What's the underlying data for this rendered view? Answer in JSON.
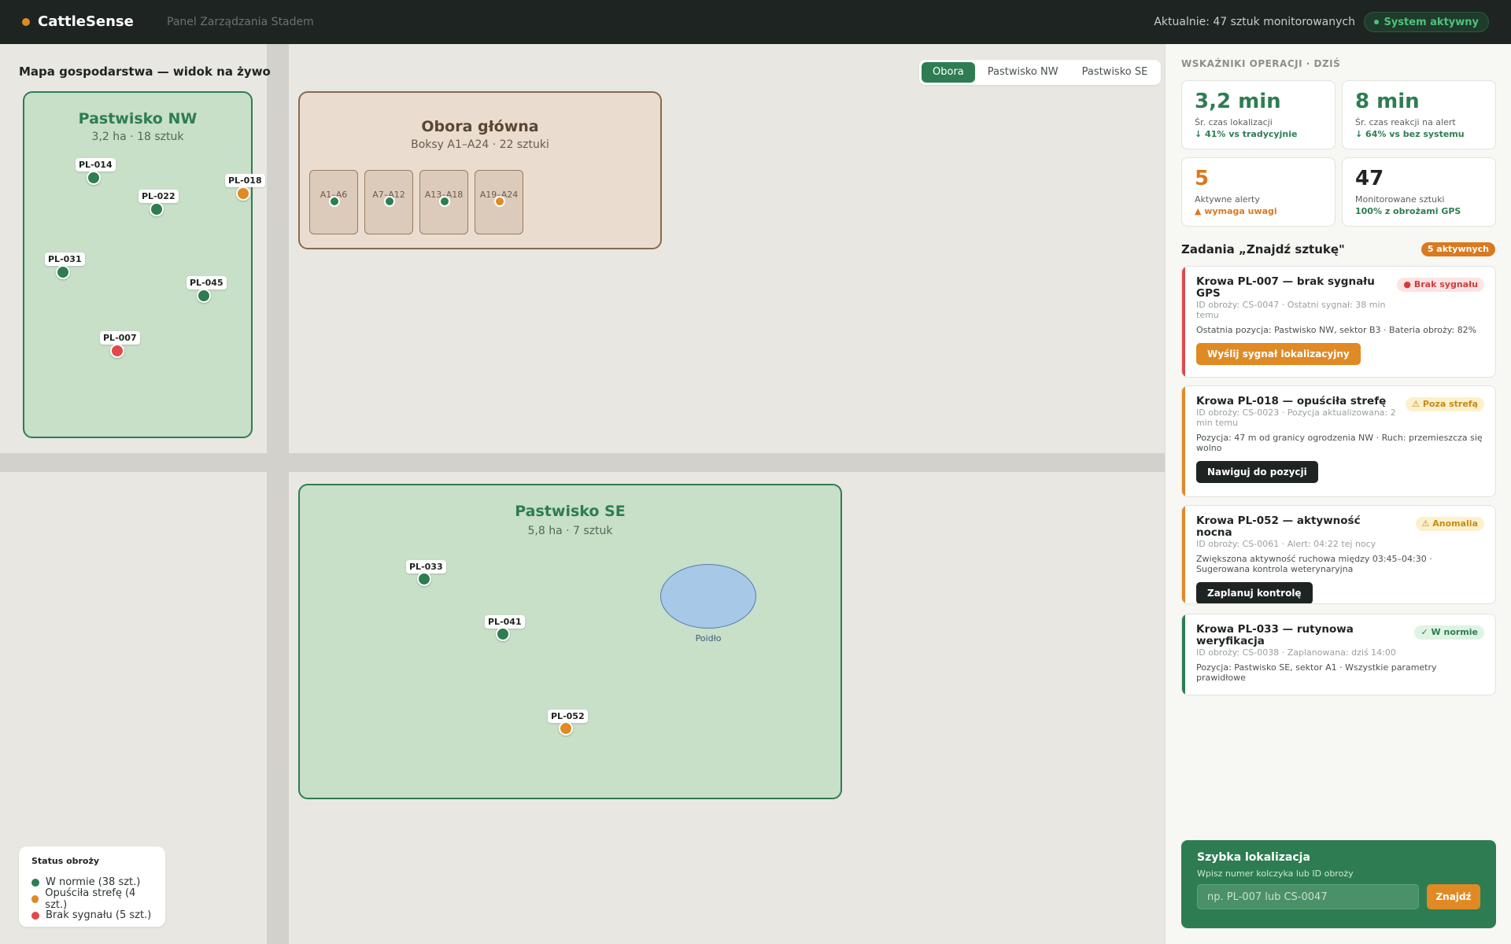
{
  "header": {
    "brand": "CattleSense",
    "subtitle": "Panel Zarządzania Stadem",
    "monitoring": "Aktualnie: 47 sztuk monitorowanych",
    "system_status": "System aktywny"
  },
  "map": {
    "title": "Mapa gospodarstwa — widok na żywo",
    "tabs": [
      "Obora",
      "Pastwisko NW",
      "Pastwisko SE"
    ],
    "active_tab": "Obora",
    "zones": {
      "nw": {
        "name": "Pastwisko NW",
        "meta": "3,2 ha · 18 sztuk"
      },
      "barn": {
        "name": "Obora główna",
        "meta": "Boksy A1–A24 · 22 sztuki",
        "boxes": [
          "A1–A6",
          "A7–A12",
          "A13–A18",
          "A19–A24"
        ]
      },
      "se": {
        "name": "Pastwisko SE",
        "meta": "5,8 ha · 7 sztuk",
        "pond": "Poidło"
      }
    },
    "cows": [
      {
        "id": "PL-014",
        "status": "ok"
      },
      {
        "id": "PL-022",
        "status": "ok"
      },
      {
        "id": "PL-018",
        "status": "outside"
      },
      {
        "id": "PL-031",
        "status": "ok"
      },
      {
        "id": "PL-045",
        "status": "ok"
      },
      {
        "id": "PL-007",
        "status": "nosignal"
      },
      {
        "id": "PL-033",
        "status": "ok"
      },
      {
        "id": "PL-041",
        "status": "ok"
      },
      {
        "id": "PL-052",
        "status": "outside"
      }
    ],
    "legend": {
      "title": "Status obroży",
      "items": [
        "W normie (38 szt.)",
        "Opuściła strefę (4 szt.)",
        "Brak sygnału (5 szt.)"
      ]
    }
  },
  "colors": {
    "ok": "#2e7d52",
    "outside": "#e08a25",
    "nosignal": "#e04a4a",
    "dark": "#1e2421"
  },
  "panel": {
    "heading": "WSKAŹNIKI OPERACJI · DZIŚ",
    "kpis": [
      {
        "value": "3,2 min",
        "label": "Śr. czas lokalizacji",
        "delta": "↓ 41% vs tradycyjnie"
      },
      {
        "value": "8 min",
        "label": "Śr. czas reakcji na alert",
        "delta": "↓ 64% vs bez systemu"
      },
      {
        "value": "5",
        "label": "Aktywne alerty",
        "delta": "▲ wymaga uwagi"
      },
      {
        "value": "47",
        "label": "Monitorowane sztuki",
        "delta": "100% z obrożami GPS"
      }
    ],
    "tasks_title": "Zadania „Znajdź sztukę\"",
    "tasks_badge": "5 aktywnych",
    "tasks": [
      {
        "title": "Krowa PL-007 — brak sygnału GPS",
        "id_line": "ID obroży: CS-0047 · Ostatni sygnał: 38 min temu",
        "desc": "Ostatnia pozycja: Pastwisko NW, sektor B3 · Bateria obroży: 82%",
        "tag": "● Brak sygnału",
        "button": "Wyślij sygnał lokalizacyjny"
      },
      {
        "title": "Krowa PL-018 — opuściła strefę",
        "id_line": "ID obroży: CS-0023 · Pozycja aktualizowana: 2 min temu",
        "desc": "Pozycja: 47 m od granicy ogrodzenia NW · Ruch: przemieszcza się wolno",
        "tag": "⚠ Poza strefą",
        "button": "Nawiguj do pozycji"
      },
      {
        "title": "Krowa PL-052 — aktywność nocna",
        "id_line": "ID obroży: CS-0061 · Alert: 04:22 tej nocy",
        "desc": "Zwiększona aktywność ruchowa między 03:45–04:30 · Sugerowana kontrola weterynaryjna",
        "tag": "⚠ Anomalia",
        "button": "Zaplanuj kontrolę"
      },
      {
        "title": "Krowa PL-033 — rutynowa weryfikacja",
        "id_line": "ID obroży: CS-0038 · Zaplanowana: dziś 14:00",
        "desc": "Pozycja: Pastwisko SE, sektor A1 · Wszystkie parametry prawidłowe",
        "tag": "✓ W normie",
        "button": ""
      }
    ],
    "quick": {
      "title": "Szybka lokalizacja",
      "subtitle": "Wpisz numer kolczyka lub ID obroży",
      "placeholder": "np. PL-007 lub CS-0047",
      "button": "Znajdź"
    }
  }
}
